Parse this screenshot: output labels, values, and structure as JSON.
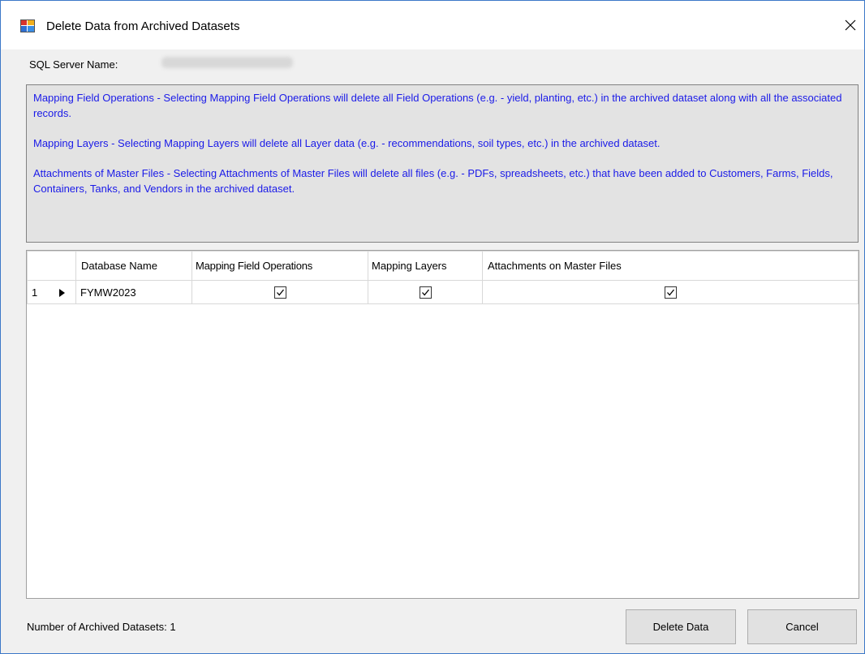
{
  "window": {
    "title": "Delete Data from Archived Datasets",
    "close_label": "✕"
  },
  "server": {
    "label": "SQL Server Name:",
    "value": "",
    "value_redacted": true
  },
  "info": {
    "paragraphs": [
      "Mapping Field Operations - Selecting Mapping Field Operations will delete all Field Operations (e.g. - yield, planting, etc.) in the archived dataset along with all the associated records.",
      "Mapping Layers - Selecting Mapping Layers will delete all Layer data (e.g. - recommendations, soil types, etc.) in the archived dataset.",
      "Attachments of Master Files - Selecting Attachments of Master Files will delete all files (e.g. - PDFs, spreadsheets, etc.) that have been added to Customers, Farms, Fields, Containers, Tanks, and Vendors in the archived dataset."
    ],
    "text_color": "#1a1ae8"
  },
  "grid": {
    "columns": [
      "",
      "Database Name",
      "Mapping Field Operations",
      "Mapping Layers",
      "Attachments on Master Files"
    ],
    "rows": [
      {
        "row_number": "1",
        "current_row_indicator": "▶",
        "database_name": "FYMW2023",
        "mapping_field_operations": true,
        "mapping_layers": true,
        "attachments_on_master_files": true
      }
    ]
  },
  "footer": {
    "count_label": "Number of Archived Datasets:",
    "count_value": "1",
    "delete_button": "Delete Data",
    "cancel_button": "Cancel"
  },
  "icons": {
    "app": "app-window-icon",
    "close": "close-icon",
    "row_pointer": "row-pointer-icon",
    "checkbox": "checkbox-checked-icon"
  }
}
